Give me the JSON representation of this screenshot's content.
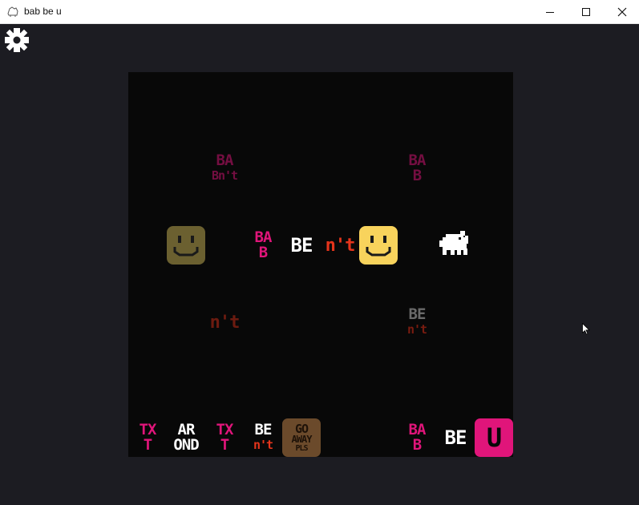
{
  "window": {
    "title": "bab be u",
    "controls": [
      "minimize",
      "maximize",
      "close"
    ]
  },
  "toolbar": {
    "settings_icon": "gear-icon"
  },
  "colors": {
    "background": "#1c1c22",
    "board": "#080808",
    "pink": "#e0157a",
    "white": "#ffffff",
    "orange_red": "#e5341b",
    "yellow": "#f8d35c",
    "brown": "#6b4a2b",
    "grey": "#6a6a6a"
  },
  "board": {
    "top_words": [
      {
        "lines": [
          "BA",
          "B"
        ],
        "extra": "n't",
        "dim": true
      },
      {
        "lines": [
          "BA",
          "B"
        ],
        "dim": true
      }
    ],
    "middle_row": {
      "rule_bab": [
        "BA",
        "B"
      ],
      "rule_be": "BE",
      "rule_not": "n't",
      "sprites": [
        "smiley-dim",
        "smiley",
        "bab-character"
      ]
    },
    "lower_words": [
      {
        "lines": [
          "n't"
        ],
        "dim": true
      },
      {
        "lines": [
          "BE",
          "n't"
        ],
        "dim": true
      }
    ],
    "bottom_row": {
      "txt1": [
        "TX",
        "T"
      ],
      "around": [
        "AR",
        "OND"
      ],
      "txt2": [
        "TX",
        "T"
      ],
      "be_not": [
        "BE",
        "n't"
      ],
      "go_away": [
        "GO",
        "AWAY",
        "PLS"
      ],
      "bab": [
        "BA",
        "B"
      ],
      "be": "BE",
      "u": "U"
    }
  }
}
